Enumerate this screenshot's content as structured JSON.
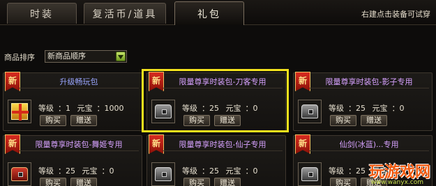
{
  "tabs": [
    {
      "label": "时装"
    },
    {
      "label": "复活币/道具"
    },
    {
      "label": "礼包"
    }
  ],
  "hint": "右建点击装备可试穿",
  "sort": {
    "label": "商品排序",
    "value": "新商品顺序"
  },
  "badge": "新",
  "items": [
    {
      "title": "升级畅玩包",
      "level_label": "等级",
      "level": "1",
      "price_label": "元宝",
      "price": "1000",
      "buy": "购买",
      "gift": "赠送",
      "icon": "gift-box"
    },
    {
      "title": "限量尊享时装包-刀客专用",
      "level_label": "等级",
      "level": "25",
      "price_label": "元宝",
      "price": "0",
      "buy": "购买",
      "gift": "赠送",
      "icon": "chest-silver"
    },
    {
      "title": "限量尊享时装包-影子专用",
      "level_label": "等级",
      "level": "25",
      "price_label": "元宝",
      "price": "0",
      "buy": "购买",
      "gift": "赠送",
      "icon": "chest-silver"
    },
    {
      "title": "限量尊享时装包-舞姬专用",
      "level_label": "等级",
      "level": "25",
      "price_label": "元宝",
      "price": "0",
      "buy": "购买",
      "gift": "赠送",
      "icon": "chest-red"
    },
    {
      "title": "限量尊享时装包-仙子专用",
      "level_label": "等级",
      "level": "25",
      "price_label": "元宝",
      "price": "0",
      "buy": "购买",
      "gift": "赠送",
      "icon": "chest-silver"
    },
    {
      "title": "仙剑(冰蓝)...专用",
      "level_label": "等级",
      "level": "25",
      "price_label": "元宝",
      "price": "0",
      "buy": "购买",
      "gift": "赠送",
      "icon": "chest-silver"
    }
  ],
  "watermark": {
    "main": "玩游戏网",
    "sub": "www.wanyx.com"
  },
  "colors": {
    "highlight": "#f3e21c",
    "title_blue": "#9aa6ff",
    "title_pink": "#d7a2ff"
  }
}
